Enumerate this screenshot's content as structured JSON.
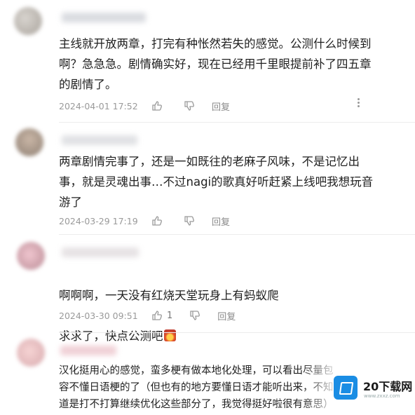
{
  "comments": [
    {
      "text": "主线就开放两章，打完有种怅然若失的感觉。公测什么时候到\n啊？急急急。剧情确实好，现在已经用千里眼提前补了四五章\n的剧情了。",
      "time": "2024-04-01 17:52",
      "like_count": "",
      "reply_label": "回复"
    },
    {
      "text": "两章剧情完事了，还是一如既往的老麻子风味，不是记忆出\n事，就是灵魂出事…不过nagi的歌真好听赶紧上线吧我想玩音\n游了",
      "time": "2024-03-29 17:19",
      "like_count": "",
      "reply_label": "回复"
    },
    {
      "text_line1": "啊啊啊，一天没有红烧天堂玩身上有蚂蚁爬",
      "text_line2": "求求了，快点公测吧",
      "emoji": "fire-emoji",
      "time": "2024-03-30 09:51",
      "like_count": "1",
      "reply_label": "回复"
    },
    {
      "text": "汉化挺用心的感觉，蛮多梗有做本地化处理，可以看出尽量包\n容不懂日语梗的了（但也有的地方要懂日语才能听出来，不知\n道是打不打算继续优化这些部分了，我觉得挺好啦很有意思）"
    }
  ],
  "watermark": {
    "title": "20下载网",
    "subtitle": "www.zxxz.com"
  },
  "colors": {
    "accent": "#1a8de4",
    "meta_text": "#9a9a9a"
  }
}
